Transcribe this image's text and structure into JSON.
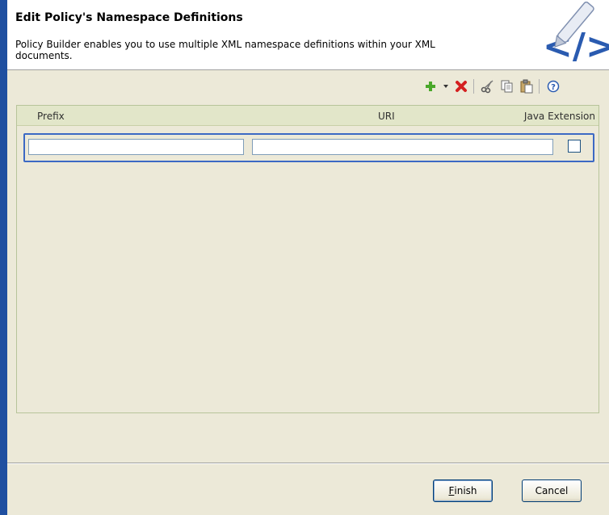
{
  "header": {
    "title": "Edit Policy's Namespace Definitions",
    "description": "Policy Builder enables you to use multiple XML namespace definitions within your XML documents."
  },
  "toolbar": {
    "icons": [
      "add-icon",
      "dropdown-arrow-icon",
      "delete-icon",
      "cut-icon",
      "copy-icon",
      "paste-icon",
      "help-icon"
    ]
  },
  "table": {
    "columns": [
      "Prefix",
      "URI",
      "Java Extension"
    ],
    "rows": [
      {
        "prefix": "",
        "uri": "",
        "java_extension": false
      }
    ]
  },
  "buttons": {
    "finish_first": "F",
    "finish_rest": "inish",
    "cancel": "Cancel"
  },
  "colors": {
    "accent_blue": "#3c69c4",
    "left_edge": "#1f4fa0",
    "dialog_bg": "#ece9d8",
    "table_header_bg": "#e2e6c9"
  }
}
